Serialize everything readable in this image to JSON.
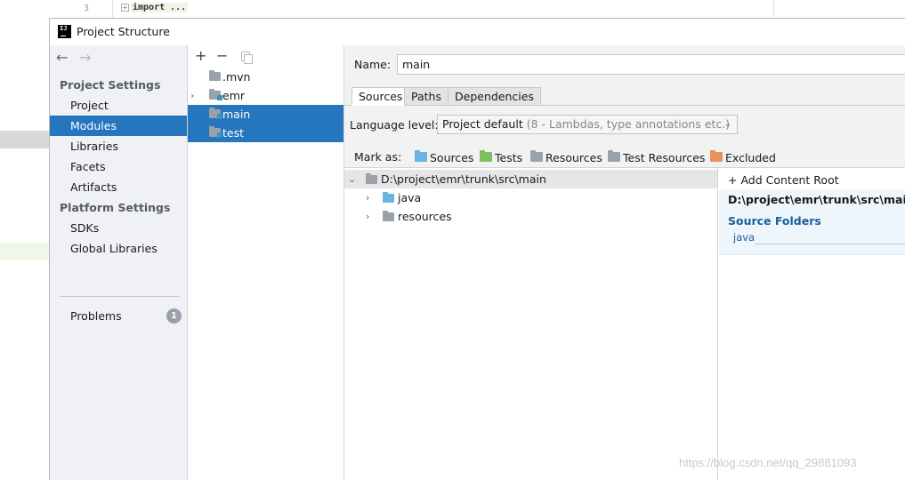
{
  "editor": {
    "line_number": "3",
    "fold_symbol": "+",
    "code_text": "import ..."
  },
  "dialog": {
    "title": "Project Structure",
    "app_icon_text": "IJ"
  },
  "nav": {
    "back_arrow": "←",
    "forward_arrow": "→",
    "project_settings_header": "Project Settings",
    "project_settings": [
      {
        "label": "Project"
      },
      {
        "label": "Modules"
      },
      {
        "label": "Libraries"
      },
      {
        "label": "Facets"
      },
      {
        "label": "Artifacts"
      }
    ],
    "platform_settings_header": "Platform Settings",
    "platform_settings": [
      {
        "label": "SDKs"
      },
      {
        "label": "Global Libraries"
      }
    ],
    "problems_label": "Problems",
    "problems_count": "1"
  },
  "modules": {
    "add_symbol": "+",
    "remove_symbol": "−",
    "items": [
      {
        "label": ".mvn"
      },
      {
        "label": "emr"
      },
      {
        "label": "main"
      },
      {
        "label": "test"
      }
    ],
    "expand_symbol": "›"
  },
  "detail": {
    "name_label": "Name:",
    "name_value": "main",
    "tabs": [
      {
        "label": "Sources"
      },
      {
        "label": "Paths"
      },
      {
        "label": "Dependencies"
      }
    ],
    "language_level_label": "Language level:",
    "language_level_value": "Project default",
    "language_level_hint": "(8 - Lambdas, type annotations etc.)",
    "dropdown_symbol": "⌄",
    "mark_as_label": "Mark as:",
    "mark_as": [
      {
        "label": "Sources",
        "color": "#6cb2e3"
      },
      {
        "label": "Tests",
        "color": "#7fbf5f"
      },
      {
        "label": "Resources",
        "color": "#9aa1a9"
      },
      {
        "label": "Test Resources",
        "color": "#9aa1a9"
      },
      {
        "label": "Excluded",
        "color": "#e8925a"
      }
    ]
  },
  "content_tree": {
    "root_path": "D:\\project\\emr\\trunk\\src\\main",
    "collapse_symbol": "⌄",
    "expand_symbol": "›",
    "children": [
      {
        "label": "java"
      },
      {
        "label": "resources"
      }
    ]
  },
  "content_roots": {
    "add_label": "+ Add Content Root",
    "root_path": "D:\\project\\emr\\trunk\\src\\main",
    "source_folders_header": "Source Folders",
    "source_folders": [
      {
        "label": "java"
      }
    ]
  },
  "watermark": "https://blog.csdn.net/qq_29881093"
}
